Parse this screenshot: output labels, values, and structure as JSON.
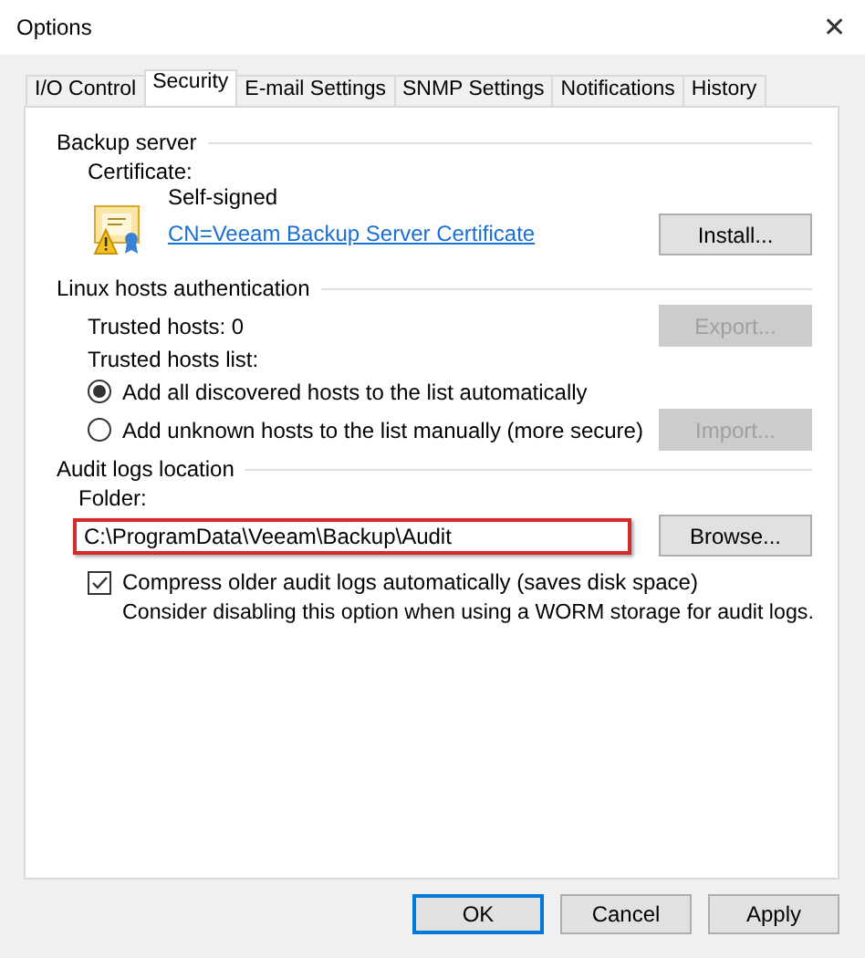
{
  "window": {
    "title": "Options",
    "close": "✕"
  },
  "tabs": [
    {
      "label": "I/O Control",
      "selected": false
    },
    {
      "label": "Security",
      "selected": true
    },
    {
      "label": "E-mail Settings",
      "selected": false
    },
    {
      "label": "SNMP Settings",
      "selected": false
    },
    {
      "label": "Notifications",
      "selected": false
    },
    {
      "label": "History",
      "selected": false
    }
  ],
  "backup_server": {
    "heading": "Backup server",
    "certificate_label": "Certificate:",
    "certificate_type": "Self-signed",
    "certificate_link": "CN=Veeam Backup Server Certificate",
    "install_button": {
      "label": "Install...",
      "disabled": false
    }
  },
  "linux_hosts": {
    "heading": "Linux hosts authentication",
    "trusted_hosts": "Trusted hosts: 0",
    "export_button": {
      "label": "Export...",
      "disabled": true
    },
    "list_label": "Trusted hosts list:",
    "options": [
      {
        "label": "Add all discovered hosts to the list automatically",
        "selected": true
      },
      {
        "label": "Add unknown hosts to the list manually (more secure)",
        "selected": false
      }
    ],
    "import_button": {
      "label": "Import...",
      "disabled": true
    }
  },
  "audit_logs": {
    "heading": "Audit logs location",
    "folder_label": "Folder:",
    "folder_value": "C:\\ProgramData\\Veeam\\Backup\\Audit",
    "highlighted": true,
    "browse_button": {
      "label": "Browse...",
      "disabled": false
    },
    "compress": {
      "label": "Compress older audit logs automatically (saves disk space)",
      "checked": true
    },
    "note": "Consider disabling this option when using a WORM storage for audit logs."
  },
  "buttons": [
    {
      "label": "OK",
      "default": true
    },
    {
      "label": "Cancel",
      "default": false
    },
    {
      "label": "Apply",
      "default": false
    }
  ]
}
